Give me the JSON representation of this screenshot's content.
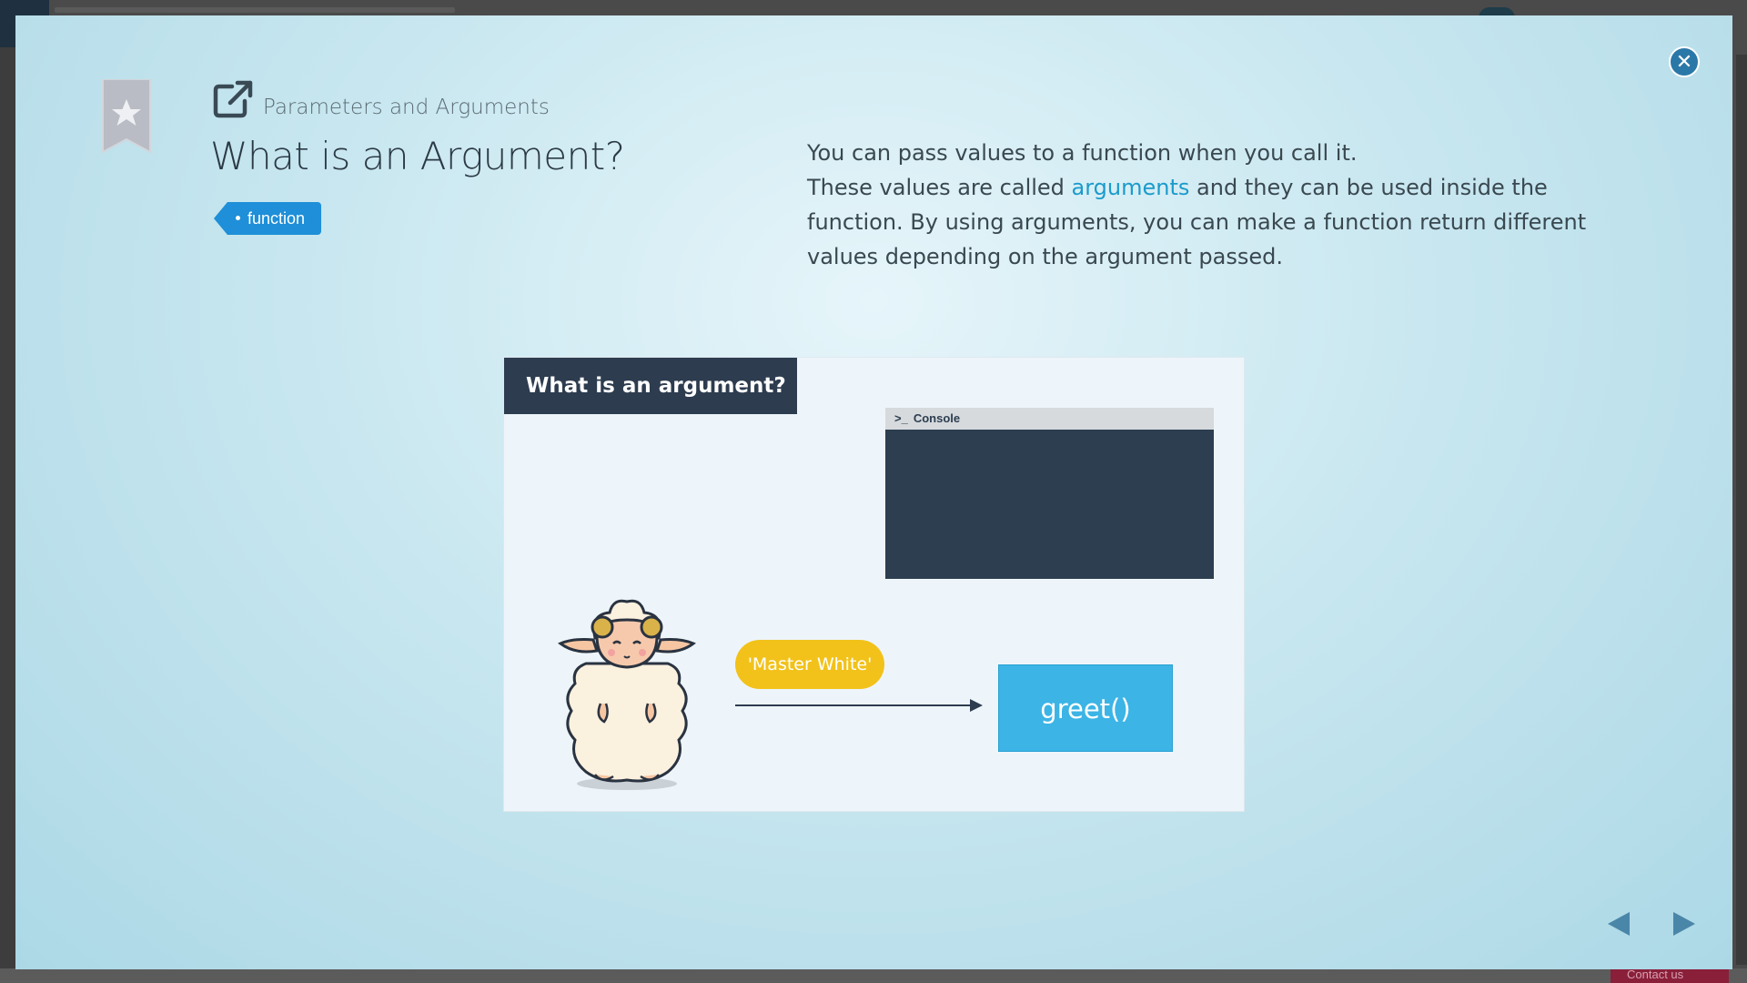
{
  "header": {
    "chapter": "Parameters and Arguments",
    "title": "What is an Argument?",
    "tag": "function"
  },
  "description": {
    "line1": "You can pass values to a function when you call it.",
    "line2_pre": "These values are called ",
    "line2_link": "arguments",
    "line2_post": " and they can be used inside the function. By using arguments, you can make a function return different values depending on the argument passed."
  },
  "slide": {
    "header": "What is an argument?",
    "console_label": "Console",
    "argument_value": "'Master White'",
    "function_call": "greet()"
  },
  "backdrop": {
    "contact_label": "Contact us"
  },
  "icons": {
    "close": "close-icon",
    "bookmark": "bookmark-star-icon",
    "external": "external-link-icon",
    "prev": "triangle-left-icon",
    "next": "triangle-right-icon"
  },
  "colors": {
    "accent": "#1e8fd8",
    "highlight": "#1a9bcb",
    "slide_header": "#2d3c4f",
    "console_bg": "#2c3e50",
    "argument_bubble": "#f2c21a",
    "function_box": "#3cb4e5",
    "close_button": "#2a78a8"
  }
}
